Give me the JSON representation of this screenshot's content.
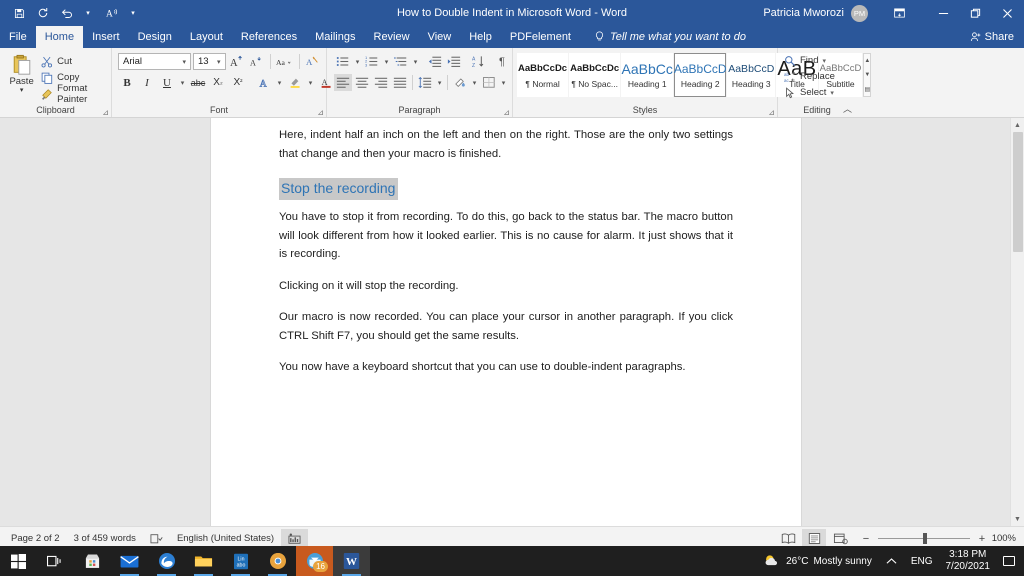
{
  "titlebar": {
    "quick_access": [
      {
        "name": "save-icon",
        "label": "Save"
      },
      {
        "name": "repeat-icon",
        "label": "Repeat"
      },
      {
        "name": "undo-icon",
        "label": "Undo"
      },
      {
        "name": "read-aloud-icon",
        "label": "Read Aloud"
      },
      {
        "name": "customize-qat-icon",
        "label": "Customize Quick Access Toolbar"
      }
    ],
    "document_title": "How to Double Indent in Microsoft Word  -  Word",
    "account_name": "Patricia Mworozi",
    "avatar_initials": "PM",
    "ribbon_display_options": "Ribbon Display Options",
    "minimize": "Minimize",
    "restore": "Restore Down",
    "close": "Close"
  },
  "tabs": [
    {
      "label": "File",
      "active": false
    },
    {
      "label": "Home",
      "active": true
    },
    {
      "label": "Insert",
      "active": false
    },
    {
      "label": "Design",
      "active": false
    },
    {
      "label": "Layout",
      "active": false
    },
    {
      "label": "References",
      "active": false
    },
    {
      "label": "Mailings",
      "active": false
    },
    {
      "label": "Review",
      "active": false
    },
    {
      "label": "View",
      "active": false
    },
    {
      "label": "Help",
      "active": false
    },
    {
      "label": "PDFelement",
      "active": false
    }
  ],
  "tell_me": "Tell me what you want to do",
  "share": "Share",
  "ribbon": {
    "clipboard": {
      "label": "Clipboard",
      "paste": "Paste",
      "items": [
        {
          "label": "Cut",
          "icon": "scissors-icon"
        },
        {
          "label": "Copy",
          "icon": "copy-icon"
        },
        {
          "label": "Format Painter",
          "icon": "format-painter-icon"
        }
      ]
    },
    "font": {
      "label": "Font",
      "font_name": "Arial",
      "font_size": "13",
      "buttons": [
        "grow-font-icon",
        "shrink-font-icon",
        "change-case-icon",
        "clear-formatting-icon",
        "bold-icon",
        "italic-icon",
        "underline-icon",
        "strikethrough-icon",
        "subscript-icon",
        "superscript-icon",
        "text-effects-icon",
        "text-highlight-icon",
        "font-color-icon"
      ]
    },
    "paragraph": {
      "label": "Paragraph",
      "buttons": [
        "bullets-icon",
        "numbering-icon",
        "multilevel-list-icon",
        "decrease-indent-icon",
        "increase-indent-icon",
        "sort-icon",
        "show-formatting-marks-icon",
        "align-left-icon",
        "align-center-icon",
        "align-right-icon",
        "justify-icon",
        "line-spacing-icon",
        "shading-icon",
        "borders-icon"
      ]
    },
    "styles": {
      "label": "Styles",
      "gallery": [
        {
          "preview": "AaBbCcDc",
          "name": "Normal",
          "selected": false,
          "kind": "normal"
        },
        {
          "preview": "AaBbCcDc",
          "name": "No Spac...",
          "selected": false,
          "kind": "nospace"
        },
        {
          "preview": "AaBbCc",
          "name": "Heading 1",
          "selected": false,
          "kind": "h1"
        },
        {
          "preview": "AaBbCcD",
          "name": "Heading 2",
          "selected": true,
          "kind": "h2"
        },
        {
          "preview": "AaBbCcD",
          "name": "Heading 3",
          "selected": false,
          "kind": "h3"
        },
        {
          "preview": "AaB",
          "name": "Title",
          "selected": false,
          "kind": "title"
        },
        {
          "preview": "AaBbCcD",
          "name": "Subtitle",
          "selected": false,
          "kind": "sub"
        }
      ]
    },
    "editing": {
      "label": "Editing",
      "items": [
        {
          "label": "Find",
          "icon": "find-icon",
          "caret": true
        },
        {
          "label": "Replace",
          "icon": "replace-icon",
          "caret": false
        },
        {
          "label": "Select",
          "icon": "select-icon",
          "caret": true
        }
      ]
    }
  },
  "document": {
    "heading": "Stop the recording",
    "paragraphs_before": [
      "Here, indent half an inch on the left and then on the right. Those are the only two settings that change and then your macro is finished."
    ],
    "paragraphs_after": [
      "You have to stop it from recording. To do this, go back to the status bar. The macro button will look different from how it looked earlier. This is no cause for alarm. It just shows that it is recording.",
      "Clicking on it will stop the recording.",
      "Our macro is now recorded. You can place your cursor in another paragraph. If you click CTRL Shift F7, you should get the same results.",
      "You now have a keyboard shortcut that you can use to double-indent paragraphs."
    ]
  },
  "status_bar": {
    "page": "Page 2 of 2",
    "words": "3 of 459 words",
    "proofing_icon": "proofing-errors-icon",
    "language": "English (United States)",
    "macro_icon": "macro-recording-icon",
    "views": [
      {
        "name": "read-mode-view",
        "selected": false
      },
      {
        "name": "print-layout-view",
        "selected": true
      },
      {
        "name": "web-layout-view",
        "selected": false
      }
    ],
    "zoom_out": "−",
    "zoom_in": "+",
    "zoom_level": "100%"
  },
  "taskbar": {
    "buttons": [
      {
        "name": "start-button",
        "label": "Start"
      },
      {
        "name": "task-view-button",
        "label": "Task View"
      },
      {
        "name": "microsoft-store-icon",
        "label": "Microsoft Store"
      },
      {
        "name": "mail-icon",
        "label": "Mail"
      },
      {
        "name": "edge-icon",
        "label": "Microsoft Edge"
      },
      {
        "name": "file-explorer-icon",
        "label": "File Explorer"
      },
      {
        "name": "blue-app-icon",
        "label": "App"
      },
      {
        "name": "chrome-icon",
        "label": "Google Chrome"
      },
      {
        "name": "teams-icon",
        "label": "Teams",
        "badge": "16"
      },
      {
        "name": "word-icon",
        "label": "Word"
      }
    ],
    "tray": {
      "weather_temp": "26°C",
      "weather_desc": "Mostly sunny",
      "show_hidden": "^",
      "language": "ENG",
      "time": "3:18 PM",
      "date": "7/20/2021",
      "notifications": "notifications-icon"
    }
  }
}
